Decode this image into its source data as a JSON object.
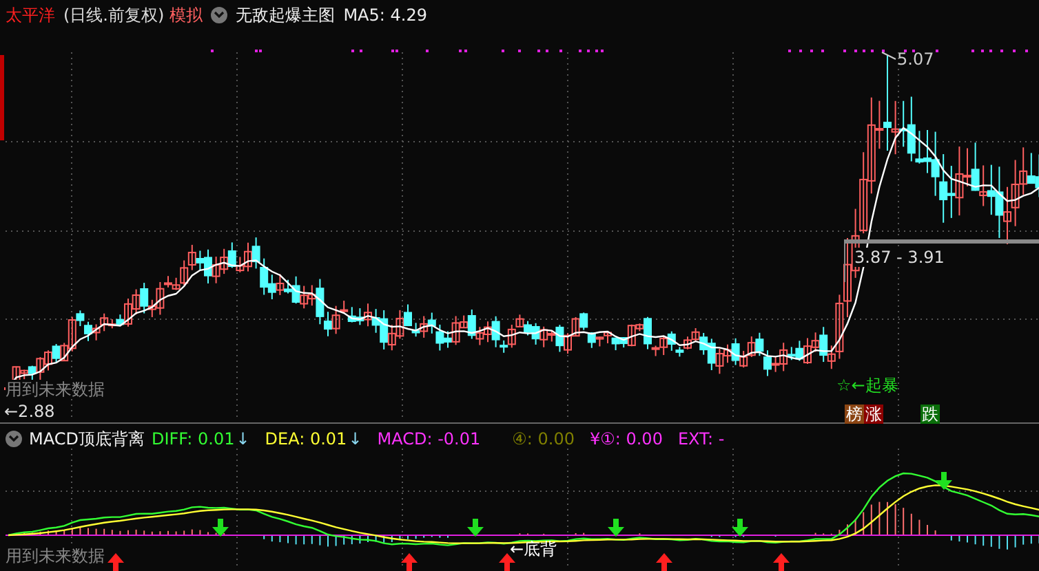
{
  "main_chart": {
    "header": {
      "stock_name": "太平洋",
      "period": "(日线.前复权)",
      "mode": "模拟",
      "indicator": "无敌起爆主图",
      "ma5": "MA5: 4.29"
    },
    "annotations": {
      "high": "5.07",
      "low": "←2.88",
      "range": "3.87 - 3.91",
      "signal": "☆←起暴",
      "warning": "用到未来数据"
    },
    "tags": [
      {
        "text": "榜",
        "color": "#8b4513"
      },
      {
        "text": "涨",
        "color": "#8b0000"
      },
      {
        "text": "跌",
        "color": "#0a6e0a"
      }
    ]
  },
  "macd_panel": {
    "title": "MACD顶底背离",
    "values": [
      {
        "text": "DIFF: 0.01",
        "color": "#33ff33",
        "trend": "↓"
      },
      {
        "text": "DEA: 0.01",
        "color": "#ffff33",
        "trend": "↓"
      },
      {
        "text": "MACD: -0.01",
        "color": "#ff33ff"
      },
      {
        "text": "④: 0.00",
        "color": "#808000"
      },
      {
        "text": "¥①: 0.00",
        "color": "#ff33ff"
      },
      {
        "text": "EXT: -",
        "color": "#ff33ff"
      }
    ],
    "annotations": {
      "divergence": "←底背",
      "warning": "用到未来数据"
    }
  }
}
